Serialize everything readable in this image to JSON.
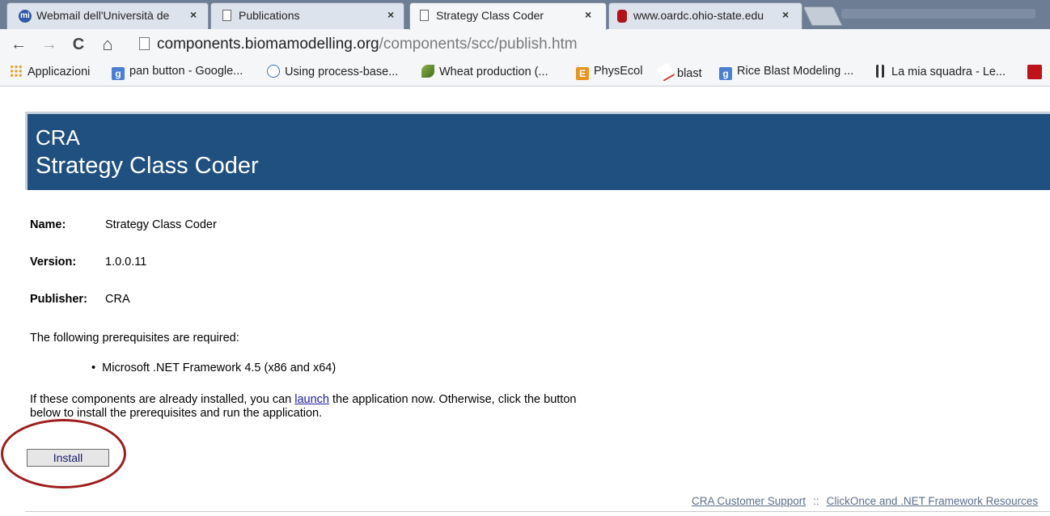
{
  "browser": {
    "tabs": [
      {
        "title": "Webmail dell'Università de",
        "active": false
      },
      {
        "title": "Publications",
        "active": false
      },
      {
        "title": "Strategy Class Coder",
        "active": true
      },
      {
        "title": "www.oardc.ohio-state.edu",
        "active": false
      }
    ],
    "close_glyph": "×",
    "nav": {
      "back": "←",
      "forward": "→",
      "reload": "C",
      "home": "⌂"
    },
    "url": {
      "host": "components.biomamodelling.org",
      "path": "/components/scc/publish.htm"
    },
    "bookmarks": [
      {
        "label": "Applicazioni",
        "icon": "apps-grid-icon",
        "color": "#e5a02b"
      },
      {
        "label": "pan button - Google...",
        "icon": "google-icon",
        "color": "#4a7fd6",
        "glyph": "g"
      },
      {
        "label": "Using process-base...",
        "icon": "globe-icon",
        "color": "#3d6fb5"
      },
      {
        "label": "Wheat production (...",
        "icon": "wheat-icon",
        "color": "#5a8a2c"
      },
      {
        "label": "PhysEcol",
        "icon": "physecol-icon",
        "color": "#e8941e",
        "glyph": "E"
      },
      {
        "label": "blast",
        "icon": "blast-icon",
        "color": "#c0392b"
      },
      {
        "label": "Rice Blast Modeling ...",
        "icon": "google-icon",
        "color": "#4a7fd6",
        "glyph": "g"
      },
      {
        "label": "La mia squadra - Le...",
        "icon": "team-icon",
        "color": "#333333"
      }
    ]
  },
  "page": {
    "banner": {
      "line1": "CRA",
      "line2": "Strategy Class Coder",
      "color": "#1f5080"
    },
    "fields": {
      "name_label": "Name:",
      "name_value": "Strategy Class Coder",
      "version_label": "Version:",
      "version_value": "1.0.0.11",
      "publisher_label": "Publisher:",
      "publisher_value": "CRA"
    },
    "prereq_intro": "The following prerequisites are required:",
    "prereq_item": "Microsoft .NET Framework 4.5 (x86 and x64)",
    "instructions": {
      "before_link": "If these components are already installed, you can ",
      "link": "launch",
      "after_link": " the application now. Otherwise, click the button below to install the prerequisites and run the application."
    },
    "install_label": "Install",
    "highlight_color": "#9f1c1c",
    "footer": {
      "support": "CRA Customer Support",
      "separator": "::",
      "resources": "ClickOnce and .NET Framework Resources"
    }
  }
}
